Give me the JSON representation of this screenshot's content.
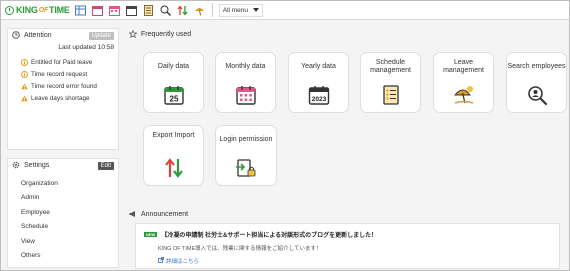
{
  "header": {
    "logo": {
      "left": "KING",
      "of": "OF",
      "right": "TIME"
    },
    "icons": [
      "table-icon",
      "calendar-icon",
      "calendar-grid-icon",
      "calendar-date-icon",
      "schedule-icon",
      "search-person-icon",
      "transfer-icon",
      "vacation-icon"
    ],
    "menu_select": "All menu"
  },
  "attention": {
    "title": "Attention",
    "update_label": "Update",
    "last_updated": "Last updated 10:58",
    "items": [
      {
        "label": "Entitled for Paid leave",
        "icon": "info-circle-icon"
      },
      {
        "label": "Time record request",
        "icon": "info-circle-icon"
      },
      {
        "label": "Time record error found",
        "icon": "warning-icon"
      },
      {
        "label": "Leave days shortage",
        "icon": "warning-icon"
      }
    ]
  },
  "settings": {
    "title": "Settings",
    "edit_label": "Edit",
    "items": [
      "Organization",
      "Admin",
      "Employee",
      "Schedule",
      "View",
      "Others"
    ]
  },
  "frequently_used": {
    "title": "Frequently used",
    "cards": [
      {
        "label": "Daily data",
        "icon": "daily-calendar-icon",
        "date": "25"
      },
      {
        "label": "Monthly data",
        "icon": "monthly-calendar-icon"
      },
      {
        "label": "Yearly data",
        "icon": "yearly-calendar-icon",
        "year": "2023"
      },
      {
        "label": "Schedule management",
        "icon": "schedule-list-icon"
      },
      {
        "label": "Leave management",
        "icon": "beach-umbrella-icon"
      },
      {
        "label": "Search employees",
        "icon": "search-person-icon"
      },
      {
        "label": "Export Import",
        "icon": "export-import-arrows-icon"
      },
      {
        "label": "Login permission",
        "icon": "login-lock-icon"
      }
    ]
  },
  "announcement": {
    "title": "Announcement",
    "badge": "NEW",
    "headline": "【冷凝の申請制 社労士&サポート担当による対談形式のブログを更新しました！",
    "body": "KING OF TIME導入では、残業に関する情報をご紹介しています！",
    "link": "詳細はこちら"
  },
  "colors": {
    "brand_green": "#2a9a3a",
    "brand_orange": "#e59c1c",
    "link_blue": "#3a73c6"
  }
}
